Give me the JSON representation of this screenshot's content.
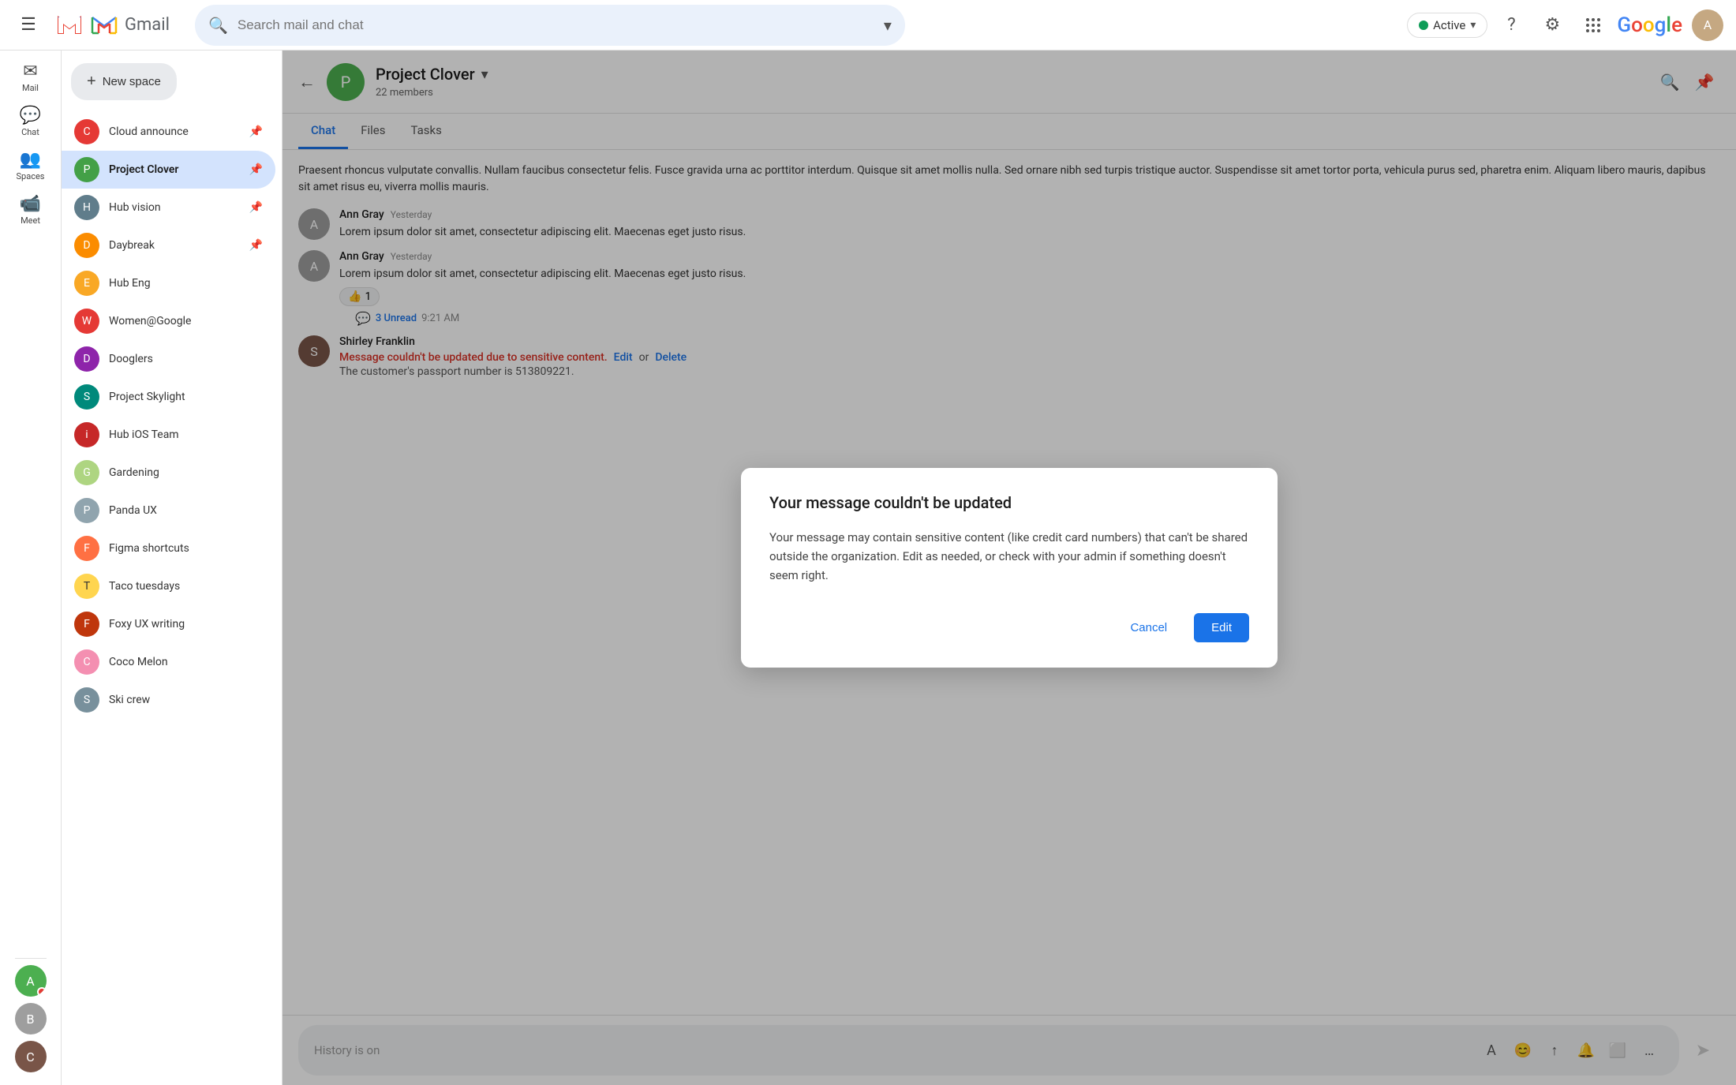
{
  "topbar": {
    "menu_icon": "☰",
    "gmail_label": "Gmail",
    "search_placeholder": "Search mail and chat",
    "search_dropdown_icon": "▾",
    "active_status": "Active",
    "help_icon": "?",
    "settings_icon": "⚙",
    "apps_icon": "⠿",
    "google_label": "Google",
    "user_initial": "A"
  },
  "left_rail": {
    "items": [
      {
        "id": "mail",
        "icon": "✉",
        "label": "Mail"
      },
      {
        "id": "chat",
        "icon": "💬",
        "label": "Chat"
      },
      {
        "id": "spaces",
        "icon": "👥",
        "label": "Spaces"
      },
      {
        "id": "meet",
        "icon": "📹",
        "label": "Meet"
      }
    ]
  },
  "sidebar": {
    "new_space_label": "New space",
    "spaces": [
      {
        "id": "cloud-announce",
        "name": "Cloud announce",
        "color": "#e53935",
        "initial": "C",
        "pinned": true
      },
      {
        "id": "project-clover",
        "name": "Project Clover",
        "color": "#43a047",
        "initial": "P",
        "pinned": true,
        "active": true
      },
      {
        "id": "hub-vision",
        "name": "Hub vision",
        "color": "#607d8b",
        "initial": "H",
        "pinned": true
      },
      {
        "id": "daybreak",
        "name": "Daybreak",
        "color": "#fb8c00",
        "initial": "D",
        "pinned": true
      },
      {
        "id": "hub-eng",
        "name": "Hub Eng",
        "color": "#f9a825",
        "initial": "E"
      },
      {
        "id": "women-google",
        "name": "Women@Google",
        "color": "#e53935",
        "initial": "W"
      },
      {
        "id": "dooglers",
        "name": "Dooglers",
        "color": "#8e24aa",
        "initial": "D"
      },
      {
        "id": "project-skylight",
        "name": "Project Skylight",
        "color": "#00897b",
        "initial": "S"
      },
      {
        "id": "hub-ios",
        "name": "Hub iOS Team",
        "color": "#c62828",
        "initial": "i"
      },
      {
        "id": "gardening",
        "name": "Gardening",
        "color": "#aed581",
        "initial": "G"
      },
      {
        "id": "panda-ux",
        "name": "Panda UX",
        "color": "#90a4ae",
        "initial": "P"
      },
      {
        "id": "figma-shortcuts",
        "name": "Figma shortcuts",
        "color": "#ff7043",
        "initial": "F"
      },
      {
        "id": "taco-tuesdays",
        "name": "Taco tuesdays",
        "color": "#ffd54f",
        "initial": "T"
      },
      {
        "id": "foxy-ux",
        "name": "Foxy UX writing",
        "color": "#bf360c",
        "initial": "F"
      },
      {
        "id": "coco-melon",
        "name": "Coco Melon",
        "color": "#f48fb1",
        "initial": "C"
      },
      {
        "id": "ski-crew",
        "name": "Ski crew",
        "color": "#78909c",
        "initial": "S"
      }
    ]
  },
  "chat": {
    "back_icon": "←",
    "title": "Project Clover",
    "members": "22 members",
    "search_icon": "🔍",
    "pin_icon": "📌",
    "tabs": [
      {
        "id": "chat",
        "label": "Chat",
        "active": true
      },
      {
        "id": "files",
        "label": "Files"
      },
      {
        "id": "tasks",
        "label": "Tasks"
      }
    ],
    "intro_text": "Praesent rhoncus vulputate convallis. Nullam faucibus consectetur felis. Fusce gravida urna ac porttitor interdum. Quisque sit amet mollis nulla. Sed ornare nibh sed turpis tristique auctor.\nSuspendisse sit amet tortor porta, vehicula purus sed, pharetra enim. Aliquam libero mauris, dapibus sit amet risus eu, viverra mollis mauris.",
    "messages": [
      {
        "id": "msg1",
        "sender": "Ann Gray",
        "time": "Yesterday",
        "body": "Lorem ipsum dolor sit amet, consectetur adipiscing elit. Maecenas eget justo risus.",
        "avatar_color": "#9e9e9e",
        "avatar_initial": "A"
      },
      {
        "id": "msg2",
        "sender": "Ann Gray",
        "time": "Yesterday",
        "body": "Lorem ipsum dolor sit amet, consectetur adipiscing elit. Maecenas eget justo risus.",
        "avatar_color": "#9e9e9e",
        "avatar_initial": "A",
        "reaction": "👍 1",
        "unread_count": "3 Unread",
        "unread_time": "9:21 AM"
      },
      {
        "id": "msg3",
        "sender": "Shirley Franklin",
        "time": "",
        "error": "Message couldn't be updated due to sensitive content.",
        "edit_label": "Edit",
        "delete_label": "Delete",
        "body": "The customer's passport number is 513809221.",
        "avatar_color": "#795548",
        "avatar_initial": "S"
      }
    ],
    "input_placeholder": "History is on",
    "input_tools": [
      "A",
      "😊",
      "↑",
      "🔔",
      "⬜",
      "…"
    ],
    "send_icon": "➤"
  },
  "modal": {
    "title": "Your message couldn't be updated",
    "body": "Your message may contain sensitive content (like credit card numbers) that can't be shared outside the organization. Edit as needed, or check with your admin if something doesn't seem right.",
    "cancel_label": "Cancel",
    "edit_label": "Edit"
  }
}
